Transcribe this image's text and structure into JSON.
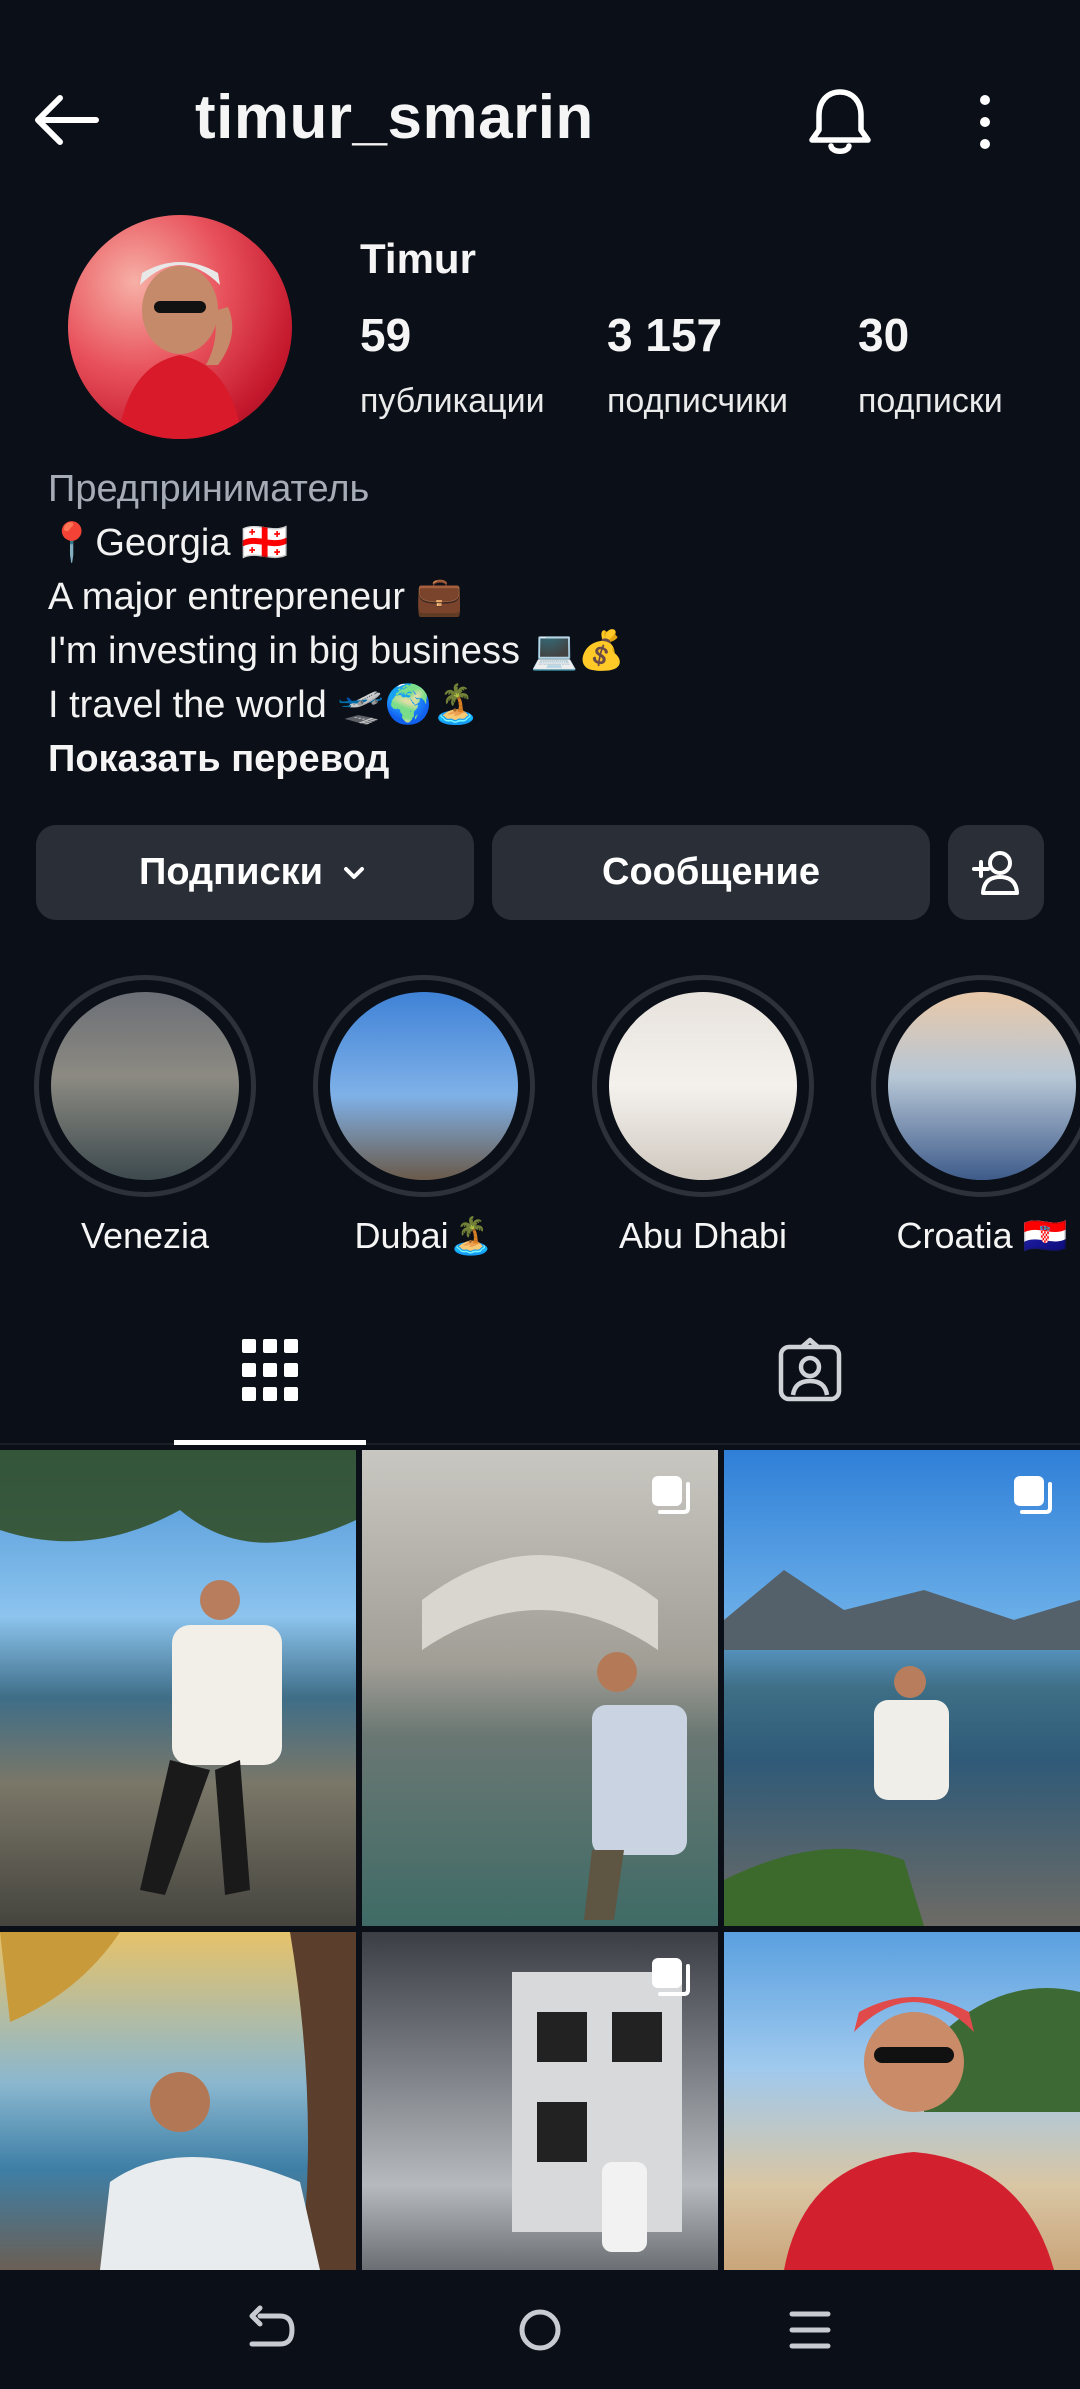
{
  "header": {
    "username": "timur_smarin"
  },
  "profile": {
    "display_name": "Timur",
    "stats": [
      {
        "value": "59",
        "label": "публикации"
      },
      {
        "value": "3 157",
        "label": "подписчики"
      },
      {
        "value": "30",
        "label": "подписки"
      }
    ],
    "bio": {
      "category": "Предприниматель",
      "lines": [
        "📍Georgia 🇬🇪",
        "A major entrepreneur 💼",
        "I'm investing in big business 💻💰",
        "I travel the world 🛫🌍🏝️"
      ],
      "show_translation": "Показать перевод"
    }
  },
  "actions": {
    "following_label": "Подписки",
    "message_label": "Сообщение"
  },
  "highlights": [
    {
      "label": "Venezia"
    },
    {
      "label": "Dubai🏝️"
    },
    {
      "label": "Abu Dhabi"
    },
    {
      "label": "Croatia 🇭🇷"
    }
  ],
  "tabs": [
    "grid-icon",
    "tagged-icon"
  ],
  "colors": {
    "background": "#0b0f17",
    "button": "#2a2f37",
    "secondary_text": "#a6acb6"
  }
}
